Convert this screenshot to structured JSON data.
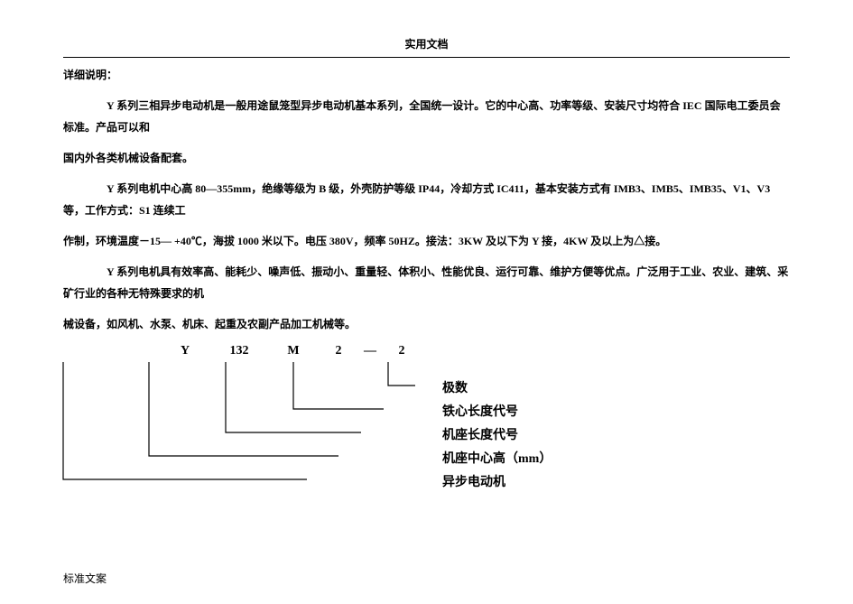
{
  "header": {
    "title": "实用文档"
  },
  "footer": {
    "text": "标准文案"
  },
  "section_title": "详细说明：",
  "paragraphs": {
    "p1_a": "Y 系列三相异步电动机是一般用途鼠笼型异步电动机基本系列，全国统一设计。它的中心高、功率等级、安装尺寸均符合 IEC 国际电工委员会标准。产品可以和",
    "p1_b": "国内外各类机械设备配套。",
    "p2_a": "Y 系列电机中心高 80—355mm，绝缘等级为 B 级，外壳防护等级 IP44，冷却方式 IC411，基本安装方式有 IMB3、IMB5、IMB35、V1、V3 等，工作方式：S1 连续工",
    "p2_b": "作制，环境温度－15— +40℃，海拔 1000 米以下。电压 380V，频率 50HZ。接法：3KW 及以下为 Y 接，4KW 及以上为△接。",
    "p3_a": "Y 系列电机具有效率高、能耗少、噪声低、振动小、重量轻、体积小、性能优良、运行可靠、维护方便等优点。广泛用于工业、农业、建筑、采矿行业的各种无特殊要求的机",
    "p3_b": "械设备，如风机、水泵、机床、起重及农副产品加工机械等。"
  },
  "diagram": {
    "segments": {
      "y": "Y",
      "n132": "132",
      "m": "M",
      "two_a": "2",
      "dash": "—",
      "two_b": "2"
    },
    "labels": {
      "poles": "极数",
      "core_len": "铁心长度代号",
      "frame_len": "机座长度代号",
      "center_h": "机座中心高（mm）",
      "async_motor": "异步电动机"
    }
  }
}
